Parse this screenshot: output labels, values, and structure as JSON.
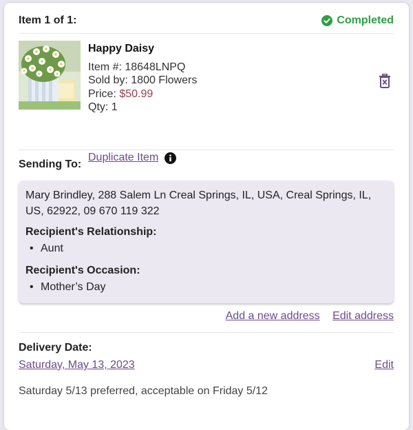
{
  "header": {
    "item_count": "Item 1 of 1:",
    "status": "Completed",
    "status_color": "#2f9e44"
  },
  "product": {
    "name": "Happy Daisy",
    "item_label": "Item #:",
    "item_number": "18648LNPQ",
    "sold_by_label": "Sold by:",
    "sold_by": "1800 Flowers",
    "price_label": "Price:",
    "price": "$50.99",
    "price_color": "#9c3c4f",
    "qty_label": "Qty:",
    "qty": "1",
    "duplicate_link": "Duplicate Item",
    "image_icon": "daisy-bouquet-image",
    "info_icon": "info-icon",
    "delete_icon": "trash-icon"
  },
  "sending": {
    "title": "Sending To:",
    "address": "Mary Brindley, 288 Salem Ln Creal Springs, IL, USA, Creal Springs, IL, US, 62922, 09 670 119 322",
    "relationship_title": "Recipient's Relationship:",
    "relationship": "Aunt",
    "occasion_title": "Recipient's Occasion:",
    "occasion": "Mother’s Day",
    "add_address": "Add a new address",
    "edit_address": "Edit address"
  },
  "delivery": {
    "title": "Delivery Date:",
    "date": "Saturday, May 13, 2023",
    "edit": "Edit",
    "note": "Saturday 5/13 preferred, acceptable on Friday 5/12"
  },
  "accent_color": "#6b4b8c"
}
